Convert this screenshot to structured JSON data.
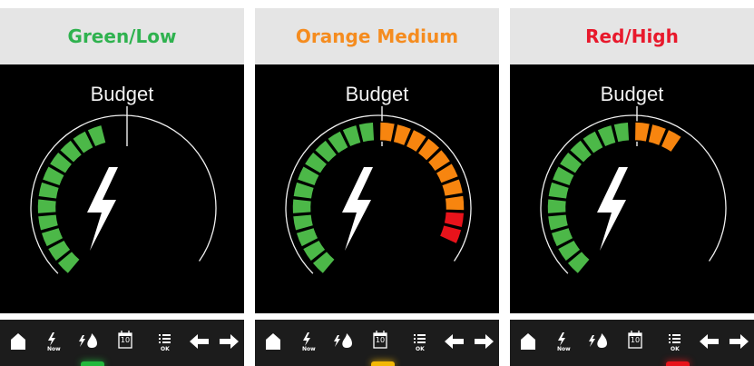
{
  "panels": [
    {
      "header": "Green/Low",
      "header_color": "#2fb24f",
      "budget_label": "Budget",
      "segment_colors": [
        "#4cb848",
        "#4cb848",
        "#4cb848",
        "#4cb848",
        "#4cb848",
        "#4cb848",
        "#4cb848",
        "#4cb848",
        "#4cb848",
        "#4cb848",
        "#4cb848"
      ],
      "active_bar_color": "#22b83c",
      "toolbar": {
        "now_label": "Now",
        "calendar_day": "10",
        "ok_label": "OK"
      }
    },
    {
      "header": "Orange Medium",
      "header_color": "#f58c1f",
      "budget_label": "Budget",
      "segment_colors": [
        "#4cb848",
        "#4cb848",
        "#4cb848",
        "#4cb848",
        "#4cb848",
        "#4cb848",
        "#4cb848",
        "#4cb848",
        "#4cb848",
        "#4cb848",
        "#4cb848",
        "#4cb848",
        "#f7850f",
        "#f7850f",
        "#f7850f",
        "#f7850f",
        "#f7850f",
        "#f7850f",
        "#f7850f",
        "#f7850f",
        "#e8131b",
        "#e8131b"
      ],
      "active_bar_color": "#f2b705",
      "toolbar": {
        "now_label": "Now",
        "calendar_day": "10",
        "ok_label": "OK"
      }
    },
    {
      "header": "Red/High",
      "header_color": "#e8192c",
      "budget_label": "Budget",
      "segment_colors": [
        "#4cb848",
        "#4cb848",
        "#4cb848",
        "#4cb848",
        "#4cb848",
        "#4cb848",
        "#4cb848",
        "#4cb848",
        "#4cb848",
        "#4cb848",
        "#4cb848",
        "#4cb848",
        "#f7850f",
        "#f7850f",
        "#f7850f"
      ],
      "active_bar_color": "#e8131b",
      "toolbar": {
        "now_label": "Now",
        "calendar_day": "10",
        "ok_label": "OK"
      }
    }
  ],
  "icons": [
    "home-icon",
    "now-icon",
    "flame-icon",
    "calendar-icon",
    "list-ok-icon",
    "arrow-left-icon",
    "arrow-right-icon"
  ]
}
